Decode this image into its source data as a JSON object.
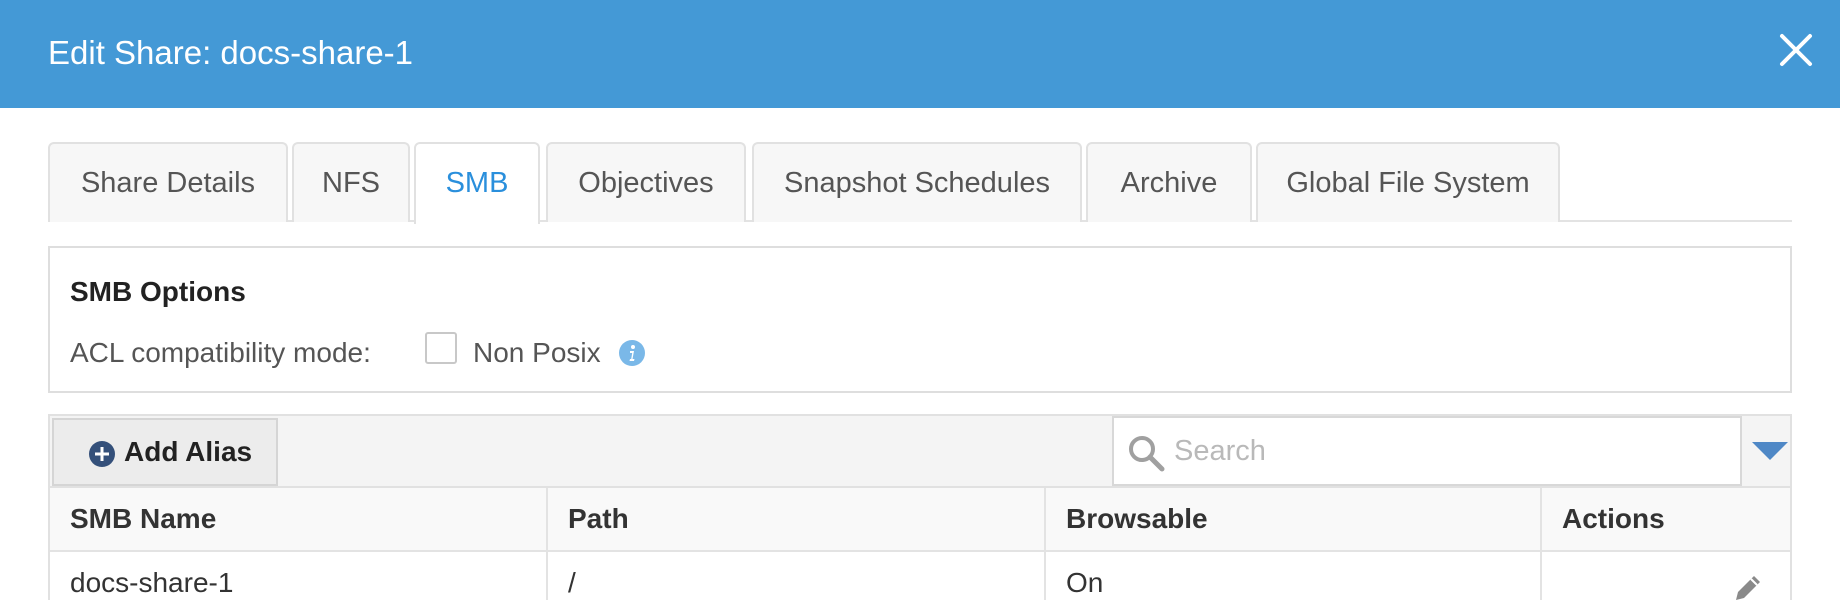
{
  "modal": {
    "title": "Edit Share: docs-share-1"
  },
  "tabs": [
    {
      "label": "Share Details",
      "active": false
    },
    {
      "label": "NFS",
      "active": false
    },
    {
      "label": "SMB",
      "active": true
    },
    {
      "label": "Objectives",
      "active": false
    },
    {
      "label": "Snapshot Schedules",
      "active": false
    },
    {
      "label": "Archive",
      "active": false
    },
    {
      "label": "Global File System",
      "active": false
    }
  ],
  "smb_options": {
    "title": "SMB Options",
    "acl_label": "ACL compatibility mode:",
    "non_posix_label": "Non Posix",
    "non_posix_checked": false
  },
  "toolbar": {
    "add_alias_label": "Add Alias",
    "search_placeholder": "Search",
    "search_value": ""
  },
  "table": {
    "columns": [
      "SMB Name",
      "Path",
      "Browsable",
      "Actions"
    ],
    "rows": [
      {
        "smb_name": "docs-share-1",
        "path": "/",
        "browsable": "On"
      }
    ]
  },
  "icons": {
    "close": "close-icon",
    "info": "info-icon",
    "add": "plus-circle-icon",
    "search": "search-icon",
    "dropdown": "caret-down-icon",
    "edit": "pencil-icon"
  },
  "colors": {
    "header_bg": "#4499d6",
    "active_tab": "#2a8fdc",
    "info_icon": "#7ab8e8",
    "add_icon": "#34507a"
  }
}
